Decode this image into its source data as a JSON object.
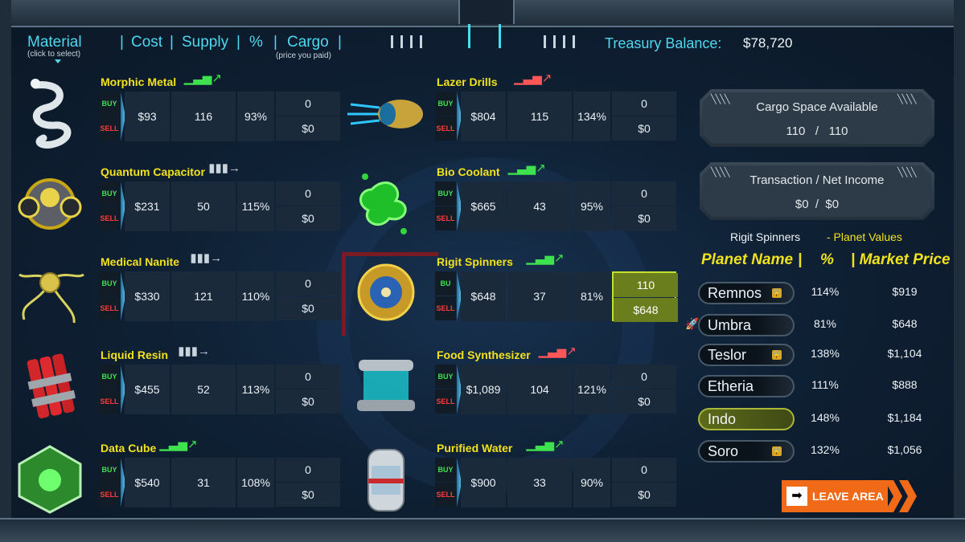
{
  "header": {
    "material_label": "Material",
    "material_sub": "(click to select)",
    "cost_label": "Cost",
    "supply_label": "Supply",
    "pct_label": "%",
    "cargo_label": "Cargo",
    "cargo_sub": "(price you paid)",
    "separator": "|",
    "treasury_label": "Treasury Balance:",
    "treasury_value": "$78,720"
  },
  "buy_label": "BUY",
  "sell_label": "SELL",
  "materials_left": [
    {
      "name": "Morphic Metal",
      "trend": "up",
      "cost": "$93",
      "supply": "116",
      "pct": "93%",
      "cargo_qty": "0",
      "cargo_price": "$0"
    },
    {
      "name": "Quantum Capacitor",
      "trend": "flat",
      "cost": "$231",
      "supply": "50",
      "pct": "115%",
      "cargo_qty": "0",
      "cargo_price": "$0"
    },
    {
      "name": "Medical Nanite",
      "trend": "flat",
      "cost": "$330",
      "supply": "121",
      "pct": "110%",
      "cargo_qty": "0",
      "cargo_price": "$0"
    },
    {
      "name": "Liquid Resin",
      "trend": "flat",
      "cost": "$455",
      "supply": "52",
      "pct": "113%",
      "cargo_qty": "0",
      "cargo_price": "$0"
    },
    {
      "name": "Data Cube",
      "trend": "up",
      "cost": "$540",
      "supply": "31",
      "pct": "108%",
      "cargo_qty": "0",
      "cargo_price": "$0"
    }
  ],
  "materials_right": [
    {
      "name": "Lazer Drills",
      "trend": "down",
      "cost": "$804",
      "supply": "115",
      "pct": "134%",
      "cargo_qty": "0",
      "cargo_price": "$0"
    },
    {
      "name": "Bio Coolant",
      "trend": "up",
      "cost": "$665",
      "supply": "43",
      "pct": "95%",
      "cargo_qty": "0",
      "cargo_price": "$0"
    },
    {
      "name": "Rigit Spinners",
      "trend": "up",
      "cost": "$648",
      "supply": "37",
      "pct": "81%",
      "cargo_qty": "110",
      "cargo_price": "$648",
      "selected": true,
      "buy_label": "BU"
    },
    {
      "name": "Food Synthesizer",
      "trend": "down",
      "cost": "$1,089",
      "supply": "104",
      "pct": "121%",
      "cargo_qty": "0",
      "cargo_price": "$0"
    },
    {
      "name": "Purified Water",
      "trend": "up",
      "cost": "$900",
      "supply": "33",
      "pct": "90%",
      "cargo_qty": "0",
      "cargo_price": "$0"
    }
  ],
  "cargo_space": {
    "title": "Cargo Space Available",
    "used": "110",
    "sep": "/",
    "total": "110"
  },
  "transaction": {
    "title": "Transaction / Net Income",
    "transaction": "$0",
    "sep": "/",
    "net": "$0"
  },
  "planet_values": {
    "item": "Rigit Spinners",
    "label": "- Planet Values",
    "col_name": "Planet Name",
    "sep": "|",
    "col_pct": "%",
    "col_price": "| Market Price",
    "planets": [
      {
        "name": "Remnos",
        "locked": true,
        "pct": "114%",
        "price": "$919"
      },
      {
        "name": "Umbra",
        "current": true,
        "pct": "81%",
        "price": "$648"
      },
      {
        "name": "Teslor",
        "locked": true,
        "pct": "138%",
        "price": "$1,104"
      },
      {
        "name": "Etheria",
        "pct": "111%",
        "price": "$888"
      },
      {
        "name": "Indo",
        "selected": true,
        "pct": "148%",
        "price": "$1,184"
      },
      {
        "name": "Soro",
        "locked": true,
        "pct": "132%",
        "price": "$1,056"
      }
    ]
  },
  "leave_button": {
    "label": "LEAVE AREA",
    "icon": "arrow-right-icon"
  },
  "colors": {
    "accent": "#4fd7ef",
    "name_yellow": "#f2e21e",
    "buy_green": "#3ee24e",
    "sell_red": "#ff3b3b",
    "leave_orange": "#f06a18",
    "trend_up": "#3ee24e",
    "trend_down": "#ff5757",
    "trend_flat": "#c9d3dd"
  }
}
